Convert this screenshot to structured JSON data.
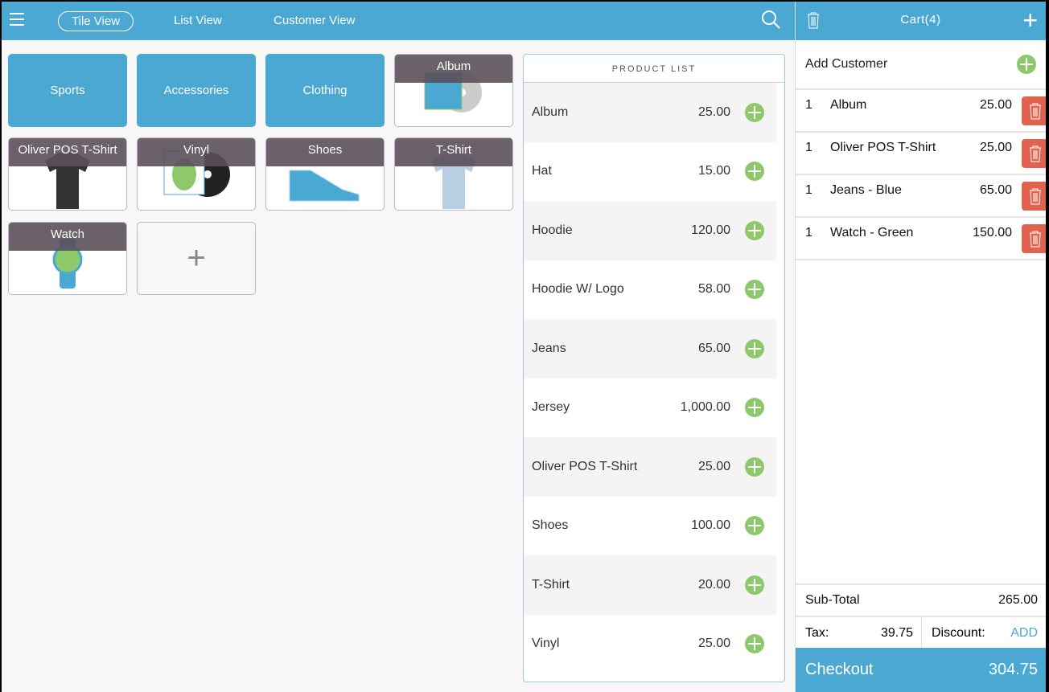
{
  "topbar": {
    "tabs": [
      "Tile View",
      "List View",
      "Customer View"
    ],
    "active_tab": "Tile View"
  },
  "tiles": {
    "categories": [
      "Sports",
      "Accessories",
      "Clothing"
    ],
    "products": [
      "Album",
      "Oliver POS T-Shirt",
      "Vinyl",
      "Shoes",
      "T-Shirt",
      "Watch"
    ],
    "add_label": "+"
  },
  "product_list": {
    "title": "PRODUCT LIST",
    "items": [
      {
        "name": "Album",
        "price": "25.00"
      },
      {
        "name": "Hat",
        "price": "15.00"
      },
      {
        "name": "Hoodie",
        "price": "120.00"
      },
      {
        "name": "Hoodie W/ Logo",
        "price": "58.00"
      },
      {
        "name": "Jeans",
        "price": "65.00"
      },
      {
        "name": "Jersey",
        "price": "1,000.00"
      },
      {
        "name": "Oliver POS T-Shirt",
        "price": "25.00"
      },
      {
        "name": "Shoes",
        "price": "100.00"
      },
      {
        "name": "T-Shirt",
        "price": "20.00"
      },
      {
        "name": "Vinyl",
        "price": "25.00"
      }
    ]
  },
  "cart": {
    "title": "Cart(4)",
    "add_customer": "Add Customer",
    "items": [
      {
        "qty": "1",
        "name": "Album",
        "price": "25.00"
      },
      {
        "qty": "1",
        "name": "Oliver POS T-Shirt",
        "price": "25.00"
      },
      {
        "qty": "1",
        "name": "Jeans - Blue",
        "price": "65.00"
      },
      {
        "qty": "1",
        "name": "Watch - Green",
        "price": "150.00"
      }
    ],
    "subtotal_label": "Sub-Total",
    "subtotal": "265.00",
    "tax_label": "Tax:",
    "tax": "39.75",
    "discount_label": "Discount:",
    "discount_action": "ADD",
    "checkout_label": "Checkout",
    "total": "304.75"
  },
  "colors": {
    "brand": "#4aa8d3",
    "add": "#8dc96a",
    "delete": "#e0634f"
  }
}
